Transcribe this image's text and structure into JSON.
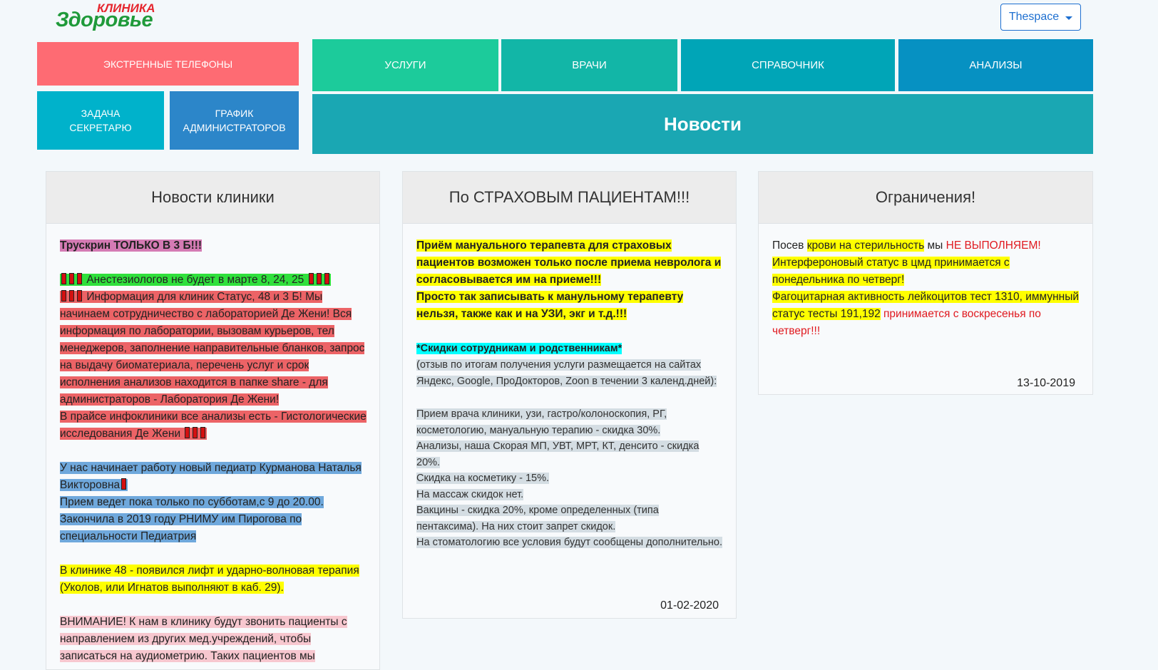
{
  "logo": {
    "top": "КЛИНИКА",
    "main": "Здоровье"
  },
  "user_menu": {
    "label": "Thespace"
  },
  "tiles": {
    "emergency": "ЭКСТРЕННЫЕ ТЕЛЕФОНЫ",
    "secretary_task": "ЗАДАЧА СЕКРЕТАРЮ",
    "admin_schedule": "ГРАФИК АДМИНИСТРАТОРОВ",
    "services": "УСЛУГИ",
    "doctors": "ВРАЧИ",
    "reference": "СПРАВОЧНИК",
    "analyses": "АНАЛИЗЫ",
    "news": "Новости"
  },
  "panel1": {
    "title": "Новости клиники",
    "heading": "Трускрин ТОЛЬКО В 3 Б!!!",
    "anesth": "Анестезиологов не будет в марте 8, 24, 25",
    "info": "Информация для клиник Статус, 48 и 3 Б! Мы начинаем сотрудничество с лабораторией Де Жени! Вся информация по лаборатории, вызовам курьеров, тел менеджеров, заполнение направительные бланков, запрос на выдачу биоматериала, перечень услуг и срок исполнения анализов находится в папке share - для администраторов - Лаборатория Де Жени!",
    "price": "В прайсе инфоклиники все анализы есть - Гистологические исследования Де Жени",
    "pediatr1": "У нас начинает работу новый педиатр Курманова Наталья Викторовна",
    "pediatr2": "Прием ведет пока только по субботам,с 9 до 20.00. Закончила в 2019 году РНИМУ им Пирогова по специальности Педиатрия",
    "lift": "В клинике 48 - появился лифт и ударно-волновая терапия (Уколов, или Игнатов выполняют в каб. 29).",
    "attention": "ВНИМАНИЕ! К нам в клинику будут звонить пациенты с направлением из других мед.учреждений, чтобы записаться на аудиометрию. Таких пациентов мы"
  },
  "panel2": {
    "title": "По СТРАХОВЫМ ПАЦИЕНТАМ!!!",
    "bold1": "Приём мануального терапевта для страховых пациентов возможен только после приема невролога и согласовывается им на приеме!!!",
    "bold2": "Просто так записывать к манульному терапевту нельзя, также как и на УЗИ, экг и т.д.!!!",
    "discount_title": "*Скидки сотрудникам и родственникам*",
    "review": "(отзыв по итогам получения услуги размещается на сайтах Яндекс, Google, ПроДокторов, Zoon в течении 3 календ.дней):",
    "d1": "Прием врача клиники, узи, гастро/колоноскопия, РГ, косметологию, мануальную терапию - скидка 30%.",
    "d2": "Анализы, наша Скорая МП, УВТ, МРТ, КТ, денсито - скидка 20%.",
    "d3": "Скидка на косметику - 15%.",
    "d4": "На массаж скидок нет.",
    "d5": "Вакцины - скидка 20%, кроме определенных (типа пентаксима). На них стоит запрет скидок.",
    "d6": "На стоматологию все условия будут сообщены дополнительно.",
    "date": "01-02-2020"
  },
  "panel3": {
    "title": "Ограничения!",
    "l1a": "Посев ",
    "l1b": "крови на стерильность",
    "l1c": " мы ",
    "l1d": "НЕ ВЫПОЛНЯЕМ!",
    "l2": "Интерфероновый статус в цмд принимается с понедельника по четверг!",
    "l3": "Фагоцитарная активность лейкоцитов тест 1310, иммунный статус тесты 191,192",
    "l3b": " принимается с воскресенья по четверг!!!",
    "date": "13-10-2019"
  }
}
